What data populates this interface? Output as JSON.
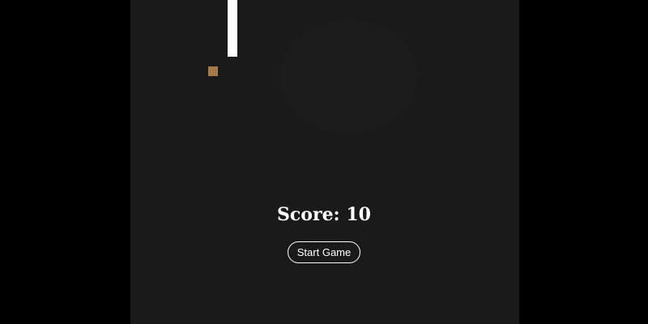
{
  "game": {
    "score_text": "Score: 10",
    "start_button_label": "Start Game",
    "score": 10
  },
  "colors": {
    "page_background": "#000000",
    "board_background": "#1a1a1a",
    "snake": "#ffffff",
    "food": "#a77a4b",
    "text": "#ffffff"
  }
}
